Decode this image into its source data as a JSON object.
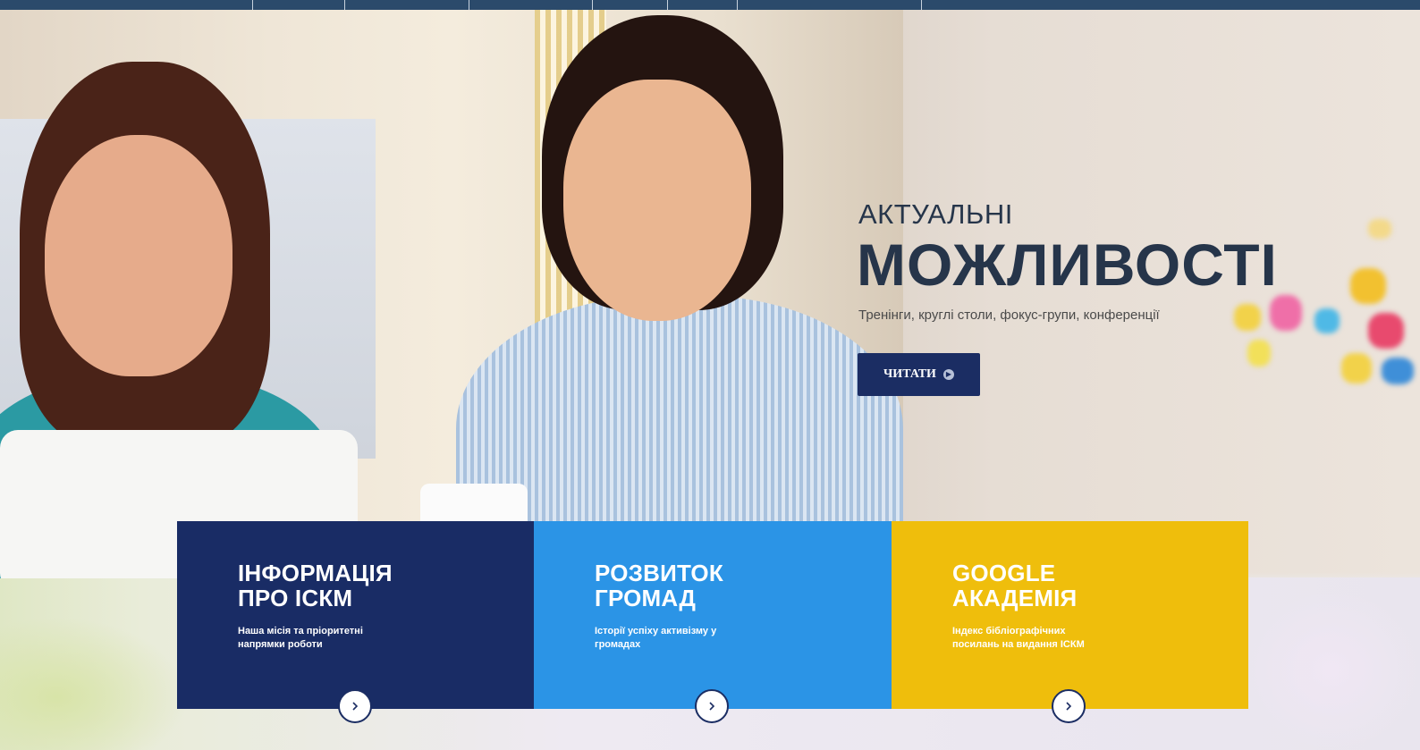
{
  "hero": {
    "kicker": "АКТУАЛЬНІ",
    "title": "МОЖЛИВОСТІ",
    "subtitle": "Тренінги, круглі столи, фокус-групи, конференції",
    "button_label": "ЧИТАТИ"
  },
  "cards": [
    {
      "title": "ІНФОРМАЦІЯ\nПРО ІСКМ",
      "description": "Наша місія та пріоритетні напрямки роботи",
      "color": "#192c65"
    },
    {
      "title": "РОЗВИТОК\nГРОМАД",
      "description": "Історії успіху активізму у громадах",
      "color": "#2b94e6"
    },
    {
      "title": "GOOGLE\nАКАДЕМІЯ",
      "description": "Індекс бібліографічних посилань на видання ІСКМ",
      "color": "#efbe0c"
    }
  ],
  "colors": {
    "nav": "#2b4a6b",
    "button": "#1b2d63",
    "heading": "#26354a"
  },
  "icons": {
    "button": "play-circle-icon",
    "card_arrow": "chevron-right-icon"
  }
}
